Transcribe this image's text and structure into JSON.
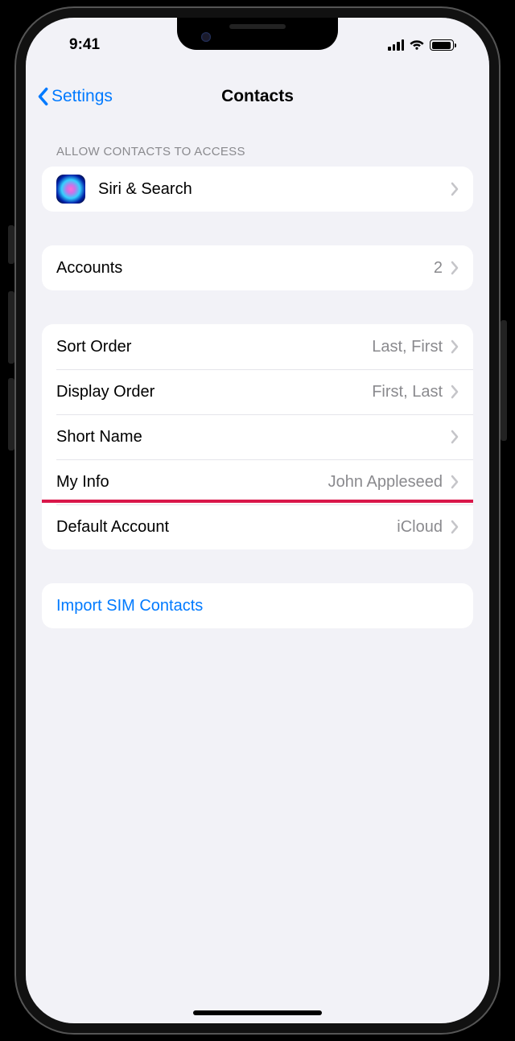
{
  "status": {
    "time": "9:41"
  },
  "nav": {
    "back_label": "Settings",
    "title": "Contacts"
  },
  "sections": {
    "access_header": "ALLOW CONTACTS TO ACCESS",
    "siri_label": "Siri & Search",
    "accounts": {
      "label": "Accounts",
      "value": "2"
    },
    "sort_order": {
      "label": "Sort Order",
      "value": "Last, First"
    },
    "display_order": {
      "label": "Display Order",
      "value": "First, Last"
    },
    "short_name": {
      "label": "Short Name"
    },
    "my_info": {
      "label": "My Info",
      "value": "John Appleseed"
    },
    "default_account": {
      "label": "Default Account",
      "value": "iCloud"
    },
    "import_sim": {
      "label": "Import SIM Contacts"
    }
  }
}
